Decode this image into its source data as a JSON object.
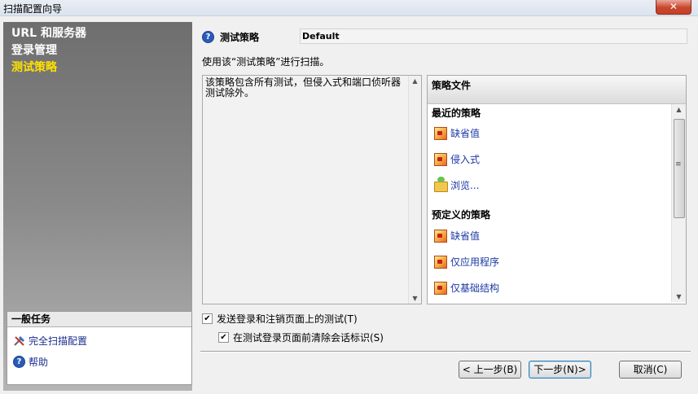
{
  "window": {
    "title": "扫描配置向导",
    "close_glyph": "✕"
  },
  "steps": [
    {
      "label": "URL 和服务器",
      "current": false
    },
    {
      "label": "登录管理",
      "current": false
    },
    {
      "label": "测试策略",
      "current": true
    }
  ],
  "tasks": {
    "header": "一般任务",
    "items": [
      {
        "label": "完全扫描配置",
        "icon": "tools-icon"
      },
      {
        "label": "帮助",
        "icon": "help-icon"
      }
    ]
  },
  "policy": {
    "label": "测试策略",
    "value": "Default",
    "use_text": "使用该“测试策略”进行扫描。",
    "description": "该策略包含所有测试，但侵入式和端口侦听器测试除外。"
  },
  "files": {
    "header": "策略文件",
    "recent_label": "最近的策略",
    "recent": [
      {
        "label": "缺省值",
        "icon": "policy-icon"
      },
      {
        "label": "侵入式",
        "icon": "policy-icon"
      },
      {
        "label": "浏览...",
        "icon": "folder-icon"
      }
    ],
    "predefined_label": "预定义的策略",
    "predefined": [
      {
        "label": "缺省值",
        "icon": "policy-icon"
      },
      {
        "label": "仅应用程序",
        "icon": "policy-icon"
      },
      {
        "label": "仅基础结构",
        "icon": "policy-icon"
      }
    ]
  },
  "options": {
    "send_login": {
      "label": "发送登录和注销页面上的测试(T)",
      "checked": true
    },
    "clear_session": {
      "label": "在测试登录页面前清除会话标识(S)",
      "checked": true
    }
  },
  "buttons": {
    "back": "< 上一步(B)",
    "next": "下一步(N)>",
    "cancel": "取消(C)"
  }
}
